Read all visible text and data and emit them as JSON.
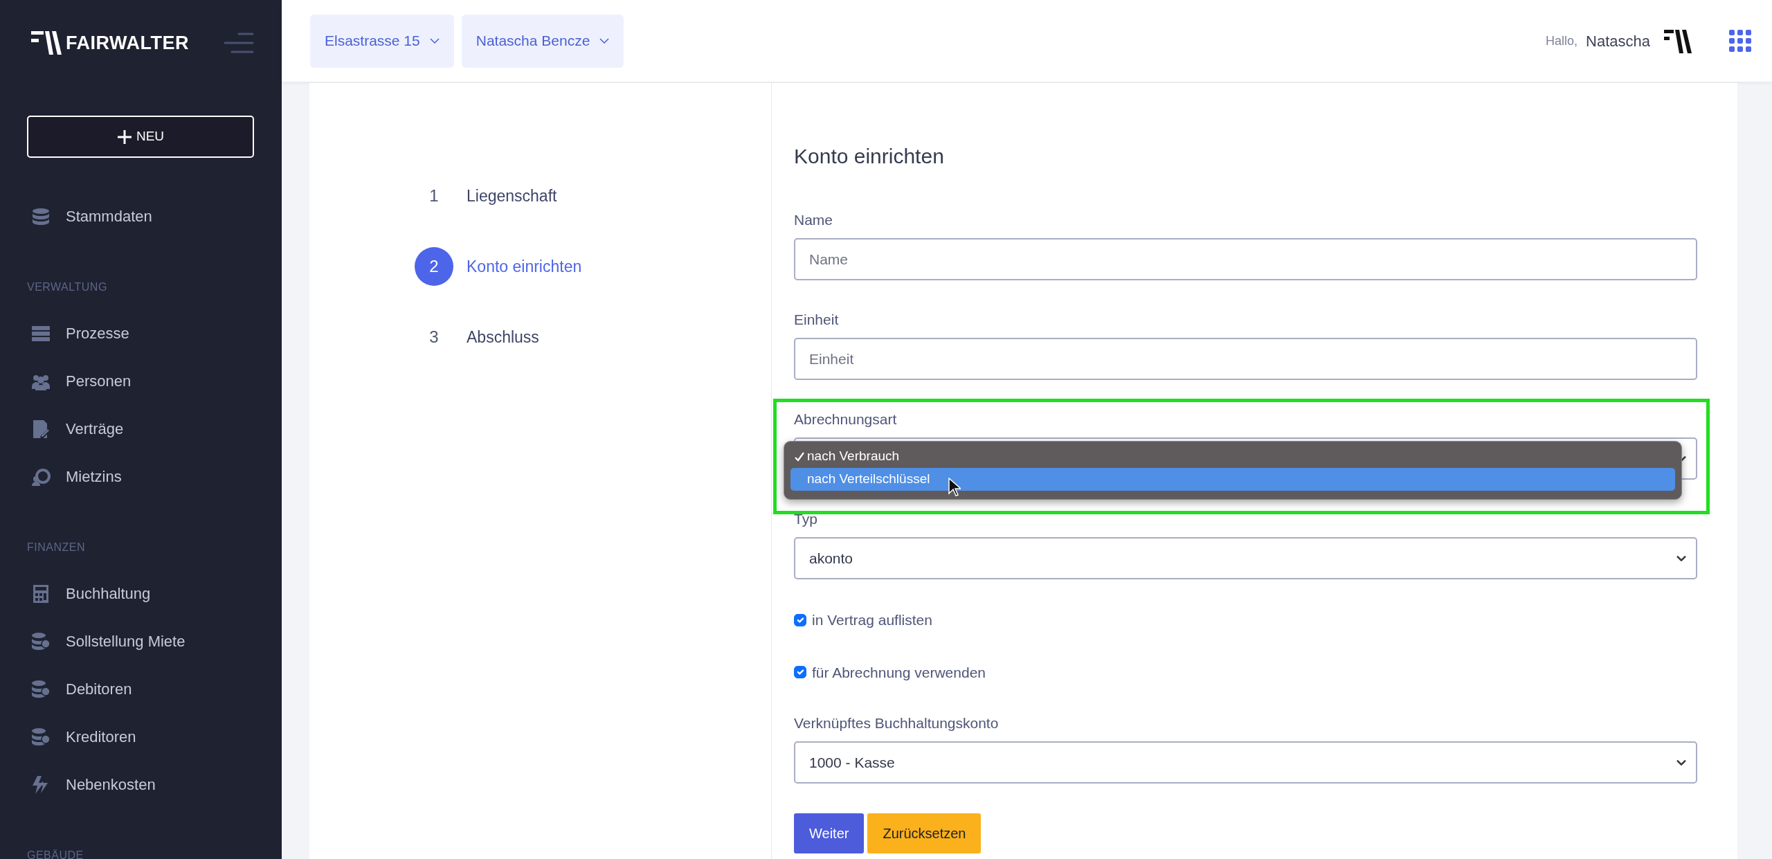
{
  "app": {
    "logo_text": "FAIRWALTER"
  },
  "sidebar": {
    "new_button": "NEU",
    "items": [
      {
        "kind": "item",
        "label": "Stammdaten"
      },
      {
        "kind": "section",
        "label": "VERWALTUNG"
      },
      {
        "kind": "item",
        "label": "Prozesse"
      },
      {
        "kind": "item",
        "label": "Personen"
      },
      {
        "kind": "item",
        "label": "Verträge"
      },
      {
        "kind": "item",
        "label": "Mietzins"
      },
      {
        "kind": "section",
        "label": "FINANZEN"
      },
      {
        "kind": "item",
        "label": "Buchhaltung"
      },
      {
        "kind": "item",
        "label": "Sollstellung Miete"
      },
      {
        "kind": "item",
        "label": "Debitoren"
      },
      {
        "kind": "item",
        "label": "Kreditoren"
      },
      {
        "kind": "item",
        "label": "Nebenkosten"
      },
      {
        "kind": "section",
        "label": "GEBÄUDE"
      }
    ]
  },
  "topbar": {
    "selectors": [
      "Elsastrasse 15",
      "Natascha Bencze"
    ],
    "greeting": "Hallo,",
    "user_name": "Natascha"
  },
  "steps": [
    {
      "number": "1",
      "label": "Liegenschaft",
      "selected": false
    },
    {
      "number": "2",
      "label": "Konto einrichten",
      "selected": true
    },
    {
      "number": "3",
      "label": "Abschluss",
      "selected": false
    }
  ],
  "form": {
    "title": "Konto einrichten",
    "fields": [
      {
        "kind": "input",
        "label": "Name",
        "placeholder": "Name"
      },
      {
        "kind": "input",
        "label": "Einheit",
        "placeholder": "Einheit"
      },
      {
        "kind": "select-open",
        "label": "Abrechnungsart",
        "highlighted": true,
        "options": [
          {
            "label": "nach Verbrauch",
            "checked": true,
            "selected": false
          },
          {
            "label": "nach Verteilschlüssel",
            "checked": false,
            "selected": true
          }
        ]
      },
      {
        "kind": "select",
        "label": "Typ",
        "value": "akonto"
      },
      {
        "kind": "checkbox",
        "label": "in Vertrag auflisten",
        "checked": true
      },
      {
        "kind": "checkbox",
        "label": "für Abrechnung verwenden",
        "checked": true
      },
      {
        "kind": "select",
        "label": "Verknüpftes Buchhaltungskonto",
        "value": "1000 - Kasse"
      }
    ],
    "buttons": [
      {
        "kind": "primary",
        "label": "Weiter"
      },
      {
        "kind": "warning",
        "label": "Zurücksetzen"
      }
    ]
  }
}
